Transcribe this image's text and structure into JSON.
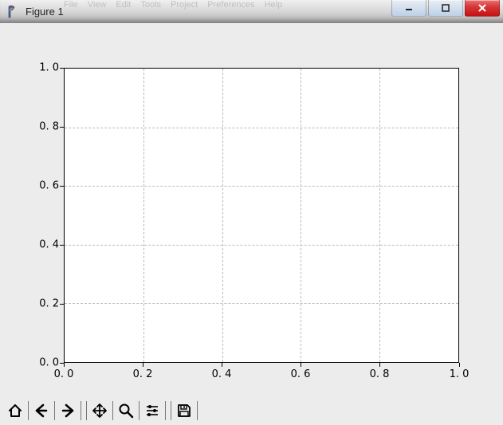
{
  "window": {
    "title": "Figure 1",
    "faded_menu": [
      "File",
      "View",
      "Edit",
      "Tools",
      "Project",
      "Preferences",
      "Help"
    ]
  },
  "win_controls": {
    "minimize": "Minimize",
    "maximize": "Maximize",
    "close": "Close"
  },
  "toolbar": {
    "home": "Home",
    "back": "Back",
    "forward": "Forward",
    "pan": "Pan",
    "zoom": "Zoom",
    "configure": "Configure subplots",
    "save": "Save"
  },
  "chart_data": {
    "type": "line",
    "series": [],
    "x_ticks": [
      "0. 0",
      "0. 2",
      "0. 4",
      "0. 6",
      "0. 8",
      "1. 0"
    ],
    "y_ticks": [
      "0. 0",
      "0. 2",
      "0. 4",
      "0. 6",
      "0. 8",
      "1. 0"
    ],
    "xlim": [
      0.0,
      1.0
    ],
    "ylim": [
      0.0,
      1.0
    ],
    "title": "",
    "xlabel": "",
    "ylabel": "",
    "grid": true,
    "legend": null
  }
}
